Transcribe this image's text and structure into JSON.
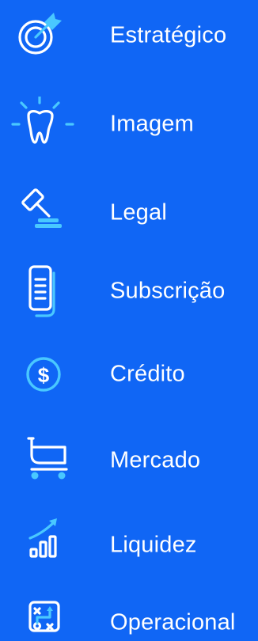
{
  "menu": {
    "items": [
      {
        "label": "Estratégico",
        "icon": "target-icon"
      },
      {
        "label": "Imagem",
        "icon": "tooth-icon"
      },
      {
        "label": "Legal",
        "icon": "gavel-icon"
      },
      {
        "label": "Subscrição",
        "icon": "documents-icon"
      },
      {
        "label": "Crédito",
        "icon": "dollar-coin-icon"
      },
      {
        "label": "Mercado",
        "icon": "shopping-cart-icon"
      },
      {
        "label": "Liquidez",
        "icon": "bar-chart-trend-icon"
      },
      {
        "label": "Operacional",
        "icon": "strategy-board-icon"
      }
    ]
  },
  "colors": {
    "background": "#1066f5",
    "text": "#ffffff",
    "accent": "#49c8ff"
  }
}
